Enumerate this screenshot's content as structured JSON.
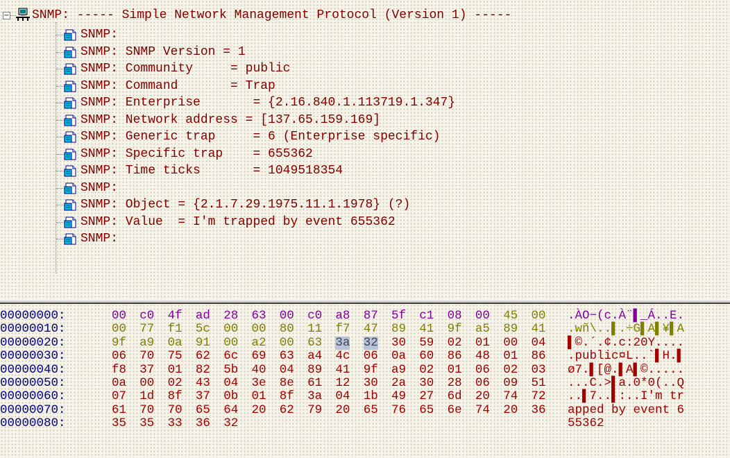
{
  "tree": {
    "root_label": "SNMP: ----- Simple Network Management Protocol (Version 1) -----",
    "root_expander": "−",
    "children": [
      "SNMP:",
      "SNMP: SNMP Version = 1",
      "SNMP: Community     = public",
      "SNMP: Command       = Trap",
      "SNMP: Enterprise       = {2.16.840.1.113719.1.347}",
      "SNMP: Network address = [137.65.159.169]",
      "SNMP: Generic trap     = 6 (Enterprise specific)",
      "SNMP: Specific trap    = 655362",
      "SNMP: Time ticks       = 1049518354",
      "SNMP:",
      "SNMP: Object = {2.1.7.29.1975.11.1.1978} (?)",
      "SNMP: Value  = I'm trapped by event 655362",
      "SNMP:"
    ]
  },
  "hex": {
    "rows": [
      {
        "offset": "00000000:",
        "bytes": [
          "00",
          "c0",
          "4f",
          "ad",
          "28",
          "63",
          "00",
          "c0",
          "a8",
          "87",
          "5f",
          "c1",
          "08",
          "00",
          "45",
          "00"
        ],
        "ascii": ".ÀO−(c.À¨▌_Á..E."
      },
      {
        "offset": "00000010:",
        "bytes": [
          "00",
          "77",
          "f1",
          "5c",
          "00",
          "00",
          "80",
          "11",
          "f7",
          "47",
          "89",
          "41",
          "9f",
          "a5",
          "89",
          "41"
        ],
        "ascii": ".wñ\\..▌.÷G▌A▌¥▌A"
      },
      {
        "offset": "00000020:",
        "bytes": [
          "9f",
          "a9",
          "0a",
          "91",
          "00",
          "a2",
          "00",
          "63",
          "3a",
          "32",
          "30",
          "59",
          "02",
          "01",
          "00",
          "04"
        ],
        "ascii": "▌©.´.¢.c:20Y...."
      },
      {
        "offset": "00000030:",
        "bytes": [
          "06",
          "70",
          "75",
          "62",
          "6c",
          "69",
          "63",
          "a4",
          "4c",
          "06",
          "0a",
          "60",
          "86",
          "48",
          "01",
          "86"
        ],
        "ascii": ".public¤L..`▌H.▌"
      },
      {
        "offset": "00000040:",
        "bytes": [
          "f8",
          "37",
          "01",
          "82",
          "5b",
          "40",
          "04",
          "89",
          "41",
          "9f",
          "a9",
          "02",
          "01",
          "06",
          "02",
          "03"
        ],
        "ascii": "ø7.▌[@.▌A▌©....."
      },
      {
        "offset": "00000050:",
        "bytes": [
          "0a",
          "00",
          "02",
          "43",
          "04",
          "3e",
          "8e",
          "61",
          "12",
          "30",
          "2a",
          "30",
          "28",
          "06",
          "09",
          "51"
        ],
        "ascii": "...C.>▌a.0*0(..Q"
      },
      {
        "offset": "00000060:",
        "bytes": [
          "07",
          "1d",
          "8f",
          "37",
          "0b",
          "01",
          "8f",
          "3a",
          "04",
          "1b",
          "49",
          "27",
          "6d",
          "20",
          "74",
          "72"
        ],
        "ascii": "..▌7..▌:..I'm tr"
      },
      {
        "offset": "00000070:",
        "bytes": [
          "61",
          "70",
          "70",
          "65",
          "64",
          "20",
          "62",
          "79",
          "20",
          "65",
          "76",
          "65",
          "6e",
          "74",
          "20",
          "36"
        ],
        "ascii": "apped by event 6"
      },
      {
        "offset": "00000080:",
        "bytes": [
          "35",
          "35",
          "33",
          "36",
          "32"
        ],
        "ascii": "55362"
      }
    ],
    "byte_colors": {
      "purple": "#8000a0",
      "olive": "#808000",
      "red": "#a00000",
      "offset": "#000080",
      "selection": "#b8c4d4"
    }
  },
  "icons": {
    "root": "network-computer-icon",
    "child": "document-node-icon"
  }
}
